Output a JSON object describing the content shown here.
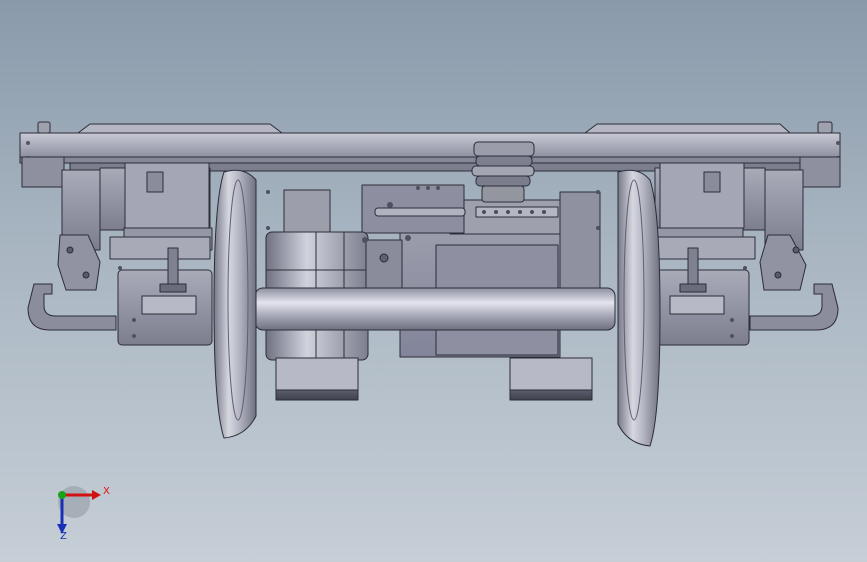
{
  "viewport": {
    "background_top": "#8a9aab",
    "background_bottom": "#c6ced6"
  },
  "model": {
    "subject": "bogie-assembly",
    "view": "front-orthographic",
    "shade_color": "#9a9cac"
  },
  "triad": {
    "x_label": "X",
    "z_label": "Z",
    "x_color": "#d11111",
    "y_color": "#1aa11a",
    "z_color": "#1a2fb8"
  }
}
